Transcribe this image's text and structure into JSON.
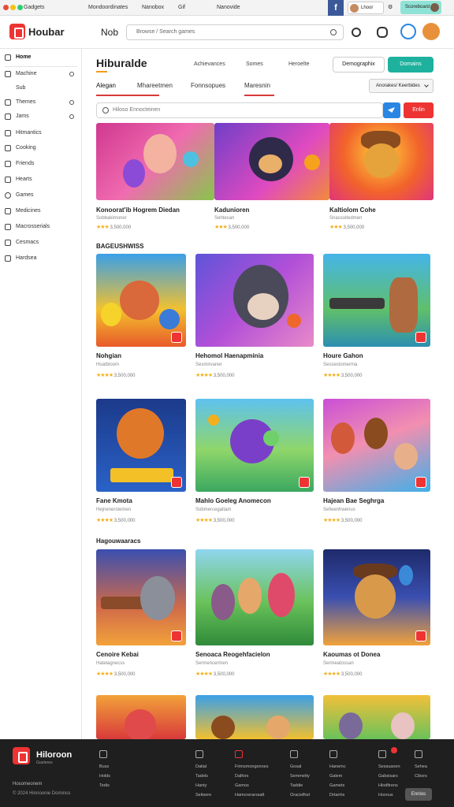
{
  "browser": {
    "tab1": "Gadgets",
    "tab2": "Mondoordinates",
    "tab3": "Nanobox",
    "tab4": "Gif",
    "tab5": "Nanovide",
    "user_label": "Lhoor",
    "pill_label": "Scoreboard"
  },
  "header": {
    "brand": "Houbar",
    "nav_label": "Nob",
    "search_placeholder": "Browse / Search games"
  },
  "sidebar": {
    "items": [
      {
        "label": "Home"
      },
      {
        "label": "Machine"
      },
      {
        "label": "Sub"
      },
      {
        "label": "Themes"
      },
      {
        "label": "Jams"
      },
      {
        "label": "Hitmantics"
      },
      {
        "label": "Cooking"
      },
      {
        "label": "Friends"
      },
      {
        "label": "Hearts"
      },
      {
        "label": "Games"
      },
      {
        "label": "Medicines"
      },
      {
        "label": "Macrosserials"
      },
      {
        "label": "Cesmacs"
      },
      {
        "label": "Hardsea"
      }
    ]
  },
  "main": {
    "title": "Hiburalde",
    "links": [
      "Achievances",
      "Somes",
      "Heroelte"
    ],
    "outline_button": "Demographix",
    "primary_button": "Domains",
    "tabs": [
      "Alegan",
      "Mhareetmen",
      "Fonnsopues",
      "Maresnin"
    ],
    "dropdown": "Anorakes/ Keerbides",
    "filter_placeholder": "Hiloso Ennocteinen",
    "filter_button": "Enlin"
  },
  "featured": [
    {
      "title": "Konoorat'ib Hogrem Diedan",
      "sub": "Sobbakimoner",
      "rating": "3,500,000"
    },
    {
      "title": "Kadunioren",
      "sub": "Sehtesan",
      "rating": "3,500,000"
    },
    {
      "title": "Kaltiolom Cohe",
      "sub": "Snassoitedmen",
      "rating": "3,500,000"
    }
  ],
  "sections": [
    {
      "heading": "BAGEUSHWISS"
    },
    {
      "heading": "Hagouwaaracs"
    }
  ],
  "grid": [
    {
      "title": "Nohgian",
      "sub": "Hoatbloom",
      "rating": "3,500,000"
    },
    {
      "title": "Hehomol Haenapminia",
      "sub": "Sesmirvaner",
      "rating": "3,500,000"
    },
    {
      "title": "Houre Gahon",
      "sub": "Sessestomerma",
      "rating": "3,500,000"
    },
    {
      "title": "Fane Kmota",
      "sub": "Hejnenerstemen",
      "rating": "3,500,000"
    },
    {
      "title": "Mahlo Goeleg Anomecon",
      "sub": "Sobmercegaltam",
      "rating": "3,500,000"
    },
    {
      "title": "Hajean Bae Seghrga",
      "sub": "Sefwenhwenus",
      "rating": "3,500,000"
    },
    {
      "title": "Cenoire Kebai",
      "sub": "Hatelagnecss",
      "rating": "3,500,000"
    },
    {
      "title": "Senoaca Reogehfacielon",
      "sub": "Sermencermen",
      "rating": "3,500,000"
    },
    {
      "title": "Kaoumas ot Donea",
      "sub": "Sermeatossan",
      "rating": "3,500,000"
    }
  ],
  "footer": {
    "brand": "Hiloroon",
    "tagline": "Gueteres",
    "copy1": "Hosomeonem",
    "copy2": "© 2024 Hinnoonie Dominos",
    "col1": [
      "Buss",
      "Holds",
      "Tedis"
    ],
    "col2": [
      "Datial",
      "Tadels",
      "Hanty",
      "Seitsere"
    ],
    "col3": [
      "Frimsmongonnes",
      "Dalfors",
      "Gamos",
      "Hamcrerarssalt"
    ],
    "col4": [
      "Gosal",
      "Semmetty",
      "Taddie",
      "Oracisfhet"
    ],
    "col5": [
      "Hanemc",
      "Galem",
      "Gamets",
      "Drtanhs"
    ],
    "col6": [
      "Sessuanen",
      "Gabsisars",
      "Hlodfirens",
      "Hoxnus"
    ],
    "col7": [
      "Sehea",
      "Cibors"
    ],
    "button": "Ennlos"
  },
  "colors": {
    "accent_red": "#e33333",
    "accent_teal": "#1db19e",
    "accent_orange": "#f59a1b",
    "star": "#f2b01e",
    "footer_bg": "#1f1f1f"
  }
}
